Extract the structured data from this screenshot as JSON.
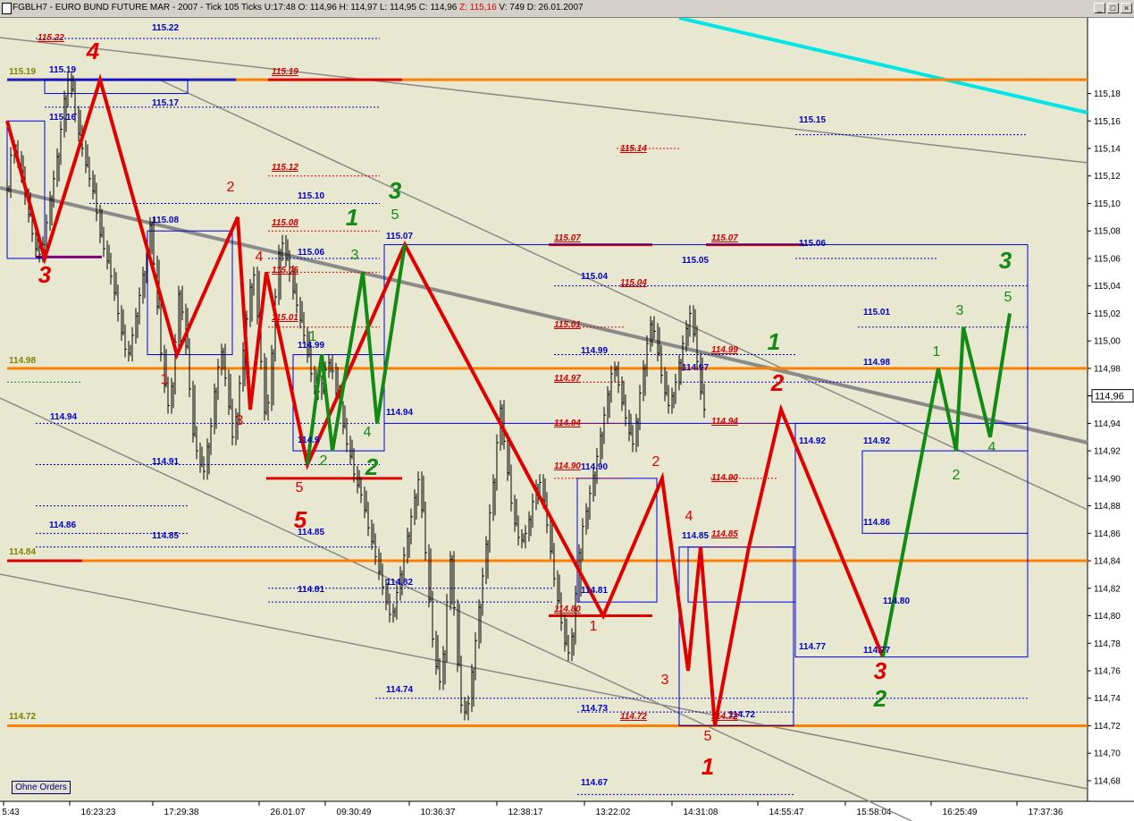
{
  "window": {
    "symbol": "FGBLH7",
    "instrument": "EURO BUND FUTURE",
    "contract": "MAR - 2007",
    "interval": "Tick 105 Ticks",
    "u_label": "U:",
    "u_value": "17:48",
    "o_label": "O:",
    "o_value": "114,96",
    "h_label": "H:",
    "h_value": "114,97",
    "l_label": "L:",
    "l_value": "114,95",
    "c_label": "C:",
    "c_value": "114,96",
    "z_label": "Z:",
    "z_value": "115,16",
    "v_label": "V:",
    "v_value": "749",
    "d_label": "D:",
    "d_value": "26.01.2007",
    "buttons": [
      "_",
      "□",
      "×"
    ]
  },
  "orders_button": "Ohne Orders",
  "chart_data": {
    "type": "line",
    "instrument": "EURO BUND FUTURE MAR - 2007",
    "colors": {
      "background": "#e8e8d0",
      "price_bars": "#000000",
      "red_wave": "#e00000",
      "green_wave": "#138a13",
      "level_orange": "#ff8000",
      "trend_gray": "#8a8a8a",
      "trend_cyan": "#00e5e5",
      "blue_box": "#0000e0",
      "axis_bg": "#ffffff"
    },
    "ylim": [
      114.665,
      115.235
    ],
    "x_ticks": [
      "5:43",
      "16:23:23",
      "17:29:38",
      "26.01.07",
      "09:30:49",
      "10:36:37",
      "12:38:17",
      "13:22:02",
      "14:31:08",
      "14:55:47",
      "15:58:04",
      "16:25:49",
      "17:37:36"
    ],
    "y_ticks": [
      "115,18",
      "115,16",
      "115,14",
      "115,12",
      "115,10",
      "115,08",
      "115,06",
      "115,04",
      "115,02",
      "115,00",
      "114,98",
      "114,96",
      "114,94",
      "114,92",
      "114,90",
      "114,88",
      "114,86",
      "114,84",
      "114,82",
      "114,80",
      "114,78",
      "114,76",
      "114,74",
      "114,72",
      "114,70",
      "114,68"
    ],
    "last_price": "114,96",
    "price_series": {
      "name": "FGBLH7",
      "x": [
        0,
        4,
        8,
        12,
        16,
        20,
        24,
        28,
        32,
        36,
        40,
        44,
        48,
        52,
        56,
        60,
        64,
        68,
        72,
        76,
        80,
        84,
        88,
        92,
        96,
        100,
        104,
        108,
        112,
        116,
        120,
        124,
        128,
        132,
        136,
        140,
        144,
        148,
        152,
        156,
        160,
        164,
        168,
        172,
        176,
        180,
        184,
        188,
        192,
        196,
        200,
        204,
        208,
        212,
        216,
        220,
        224,
        228,
        232,
        236,
        240,
        244,
        248,
        252,
        256,
        260,
        264,
        268,
        272,
        276,
        280,
        284,
        288,
        292,
        296,
        300,
        304,
        308,
        312,
        316,
        320,
        324,
        328,
        332,
        336,
        340,
        344,
        348,
        352,
        356,
        360,
        364,
        368,
        372,
        376,
        380,
        384,
        388,
        392,
        396,
        400,
        404,
        408,
        412,
        416,
        420,
        424,
        428,
        432,
        436,
        440,
        444,
        448,
        452,
        456,
        460,
        464,
        468,
        472,
        476,
        480,
        484,
        488,
        492,
        496,
        500,
        504,
        508,
        512,
        516,
        520,
        524,
        528,
        532,
        536,
        540,
        544,
        548,
        552,
        556,
        560,
        564,
        568,
        572,
        576,
        580,
        584,
        588,
        592,
        596,
        600,
        604,
        608,
        612,
        616,
        620,
        624,
        628,
        632,
        636,
        640,
        644,
        648,
        652,
        656,
        660,
        664,
        668,
        672,
        676,
        680,
        684,
        688,
        692,
        696,
        700,
        704,
        708,
        712,
        716,
        720,
        724,
        728,
        732,
        736,
        740,
        744,
        748,
        752,
        756,
        760,
        764,
        768,
        772,
        776,
        780,
        784,
        788,
        792,
        796,
        800,
        804,
        808,
        812,
        816,
        820,
        824,
        828,
        832,
        836,
        840,
        844,
        848,
        852,
        856,
        860,
        864,
        868,
        872,
        876,
        880,
        884,
        888,
        892,
        896,
        900,
        904,
        908,
        912,
        916,
        920,
        924,
        928,
        932,
        936,
        940,
        944,
        948,
        952,
        956,
        960,
        964,
        968,
        972,
        976,
        980,
        984,
        988,
        992,
        996,
        1000,
        1004,
        1008,
        1012,
        1016,
        1020,
        1024,
        1028,
        1032,
        1036,
        1040,
        1044,
        1048,
        1052,
        1056,
        1060,
        1064,
        1068,
        1072,
        1076,
        1080,
        1084,
        1088,
        1092,
        1096,
        1100,
        1104,
        1108,
        1112,
        1116,
        1120,
        1124,
        1128,
        1132,
        1136,
        1140,
        1144,
        1148,
        1152,
        1156
      ],
      "values": [
        115.11,
        115.135,
        115.14,
        115.132,
        115.121,
        115.105,
        115.092,
        115.078,
        115.067,
        115.063,
        115.07,
        115.086,
        115.103,
        115.118,
        115.134,
        115.154,
        115.176,
        115.19,
        115.183,
        115.165,
        115.151,
        115.14,
        115.128,
        115.118,
        115.109,
        115.093,
        115.077,
        115.067,
        115.058,
        115.047,
        115.035,
        115.02,
        115.006,
        114.994,
        114.991,
        115.004,
        115.018,
        115.033,
        115.048,
        115.065,
        115.084,
        115.056,
        115.025,
        114.991,
        114.968,
        114.953,
        114.967,
        114.999,
        115.034,
        115.021,
        114.996,
        114.965,
        114.932,
        114.92,
        114.91,
        114.905,
        114.923,
        114.938,
        114.963,
        114.981,
        114.992,
        114.973,
        114.952,
        114.93,
        114.945,
        114.969,
        114.993,
        115.016,
        115.039,
        115.048,
        115.018,
        114.985,
        114.948,
        114.955,
        114.991,
        115.032,
        115.064,
        115.071,
        115.06,
        115.049,
        115.036,
        115.026,
        115.015,
        115.004,
        114.99,
        114.976,
        114.967,
        114.963,
        114.969,
        114.979,
        114.984,
        114.978,
        114.962,
        114.95,
        114.938,
        114.925,
        114.916,
        114.903,
        114.895,
        114.888,
        114.877,
        114.864,
        114.854,
        114.843,
        114.832,
        114.821,
        114.81,
        114.801,
        114.803,
        114.817,
        114.83,
        114.844,
        114.858,
        114.872,
        114.886,
        114.899,
        114.877,
        114.846,
        114.812,
        114.783,
        114.763,
        114.752,
        114.772,
        114.81,
        114.841,
        114.806,
        114.765,
        114.735,
        114.73,
        114.736,
        114.759,
        114.782,
        114.806,
        114.829,
        114.852,
        114.875,
        114.897,
        114.926,
        114.951,
        114.927,
        114.904,
        114.882,
        114.867,
        114.857,
        114.855,
        114.86,
        114.87,
        114.883,
        114.893,
        114.897,
        114.884,
        114.866,
        114.847,
        114.827,
        114.811,
        114.795,
        114.78,
        114.773,
        114.785,
        114.816,
        114.846,
        114.865,
        114.876,
        114.889,
        114.902,
        114.916,
        114.931,
        114.946,
        114.961,
        114.976,
        114.979,
        114.968,
        114.955,
        114.944,
        114.933,
        114.925,
        114.941,
        114.962,
        114.98,
        114.998,
        115.012,
        115.007,
        114.991,
        114.975,
        114.962,
        114.953,
        114.96,
        114.97,
        114.984,
        114.998,
        115.009,
        115.02,
        115.005,
        114.985,
        114.963,
        114.95
      ]
    },
    "horizontal_levels": [
      {
        "value": 115.19,
        "label": "115.19"
      },
      {
        "value": 114.98,
        "label": "114.98"
      },
      {
        "value": 114.84,
        "label": "114.84"
      },
      {
        "value": 114.72,
        "label": "114.72"
      }
    ],
    "level_labels": {
      "blue": [
        {
          "label": "115.22",
          "value": 115.22
        },
        {
          "label": "115.19",
          "value": 115.19
        },
        {
          "label": "115.17",
          "value": 115.17
        },
        {
          "label": "115.16",
          "value": 115.16
        },
        {
          "label": "115.10",
          "value": 115.1
        },
        {
          "label": "115.08",
          "value": 115.08
        },
        {
          "label": "115.07",
          "value": 115.07
        },
        {
          "label": "115.06",
          "value": 115.06
        },
        {
          "label": "115.05",
          "value": 115.05
        },
        {
          "label": "115.04",
          "value": 115.04
        },
        {
          "label": "115.15",
          "value": 115.15
        },
        {
          "label": "115.06",
          "value": 115.06
        },
        {
          "label": "115.01",
          "value": 115.01
        },
        {
          "label": "114.99",
          "value": 114.99
        },
        {
          "label": "114.99",
          "value": 114.99
        },
        {
          "label": "114.98",
          "value": 114.98
        },
        {
          "label": "114.97",
          "value": 114.97
        },
        {
          "label": "114.94",
          "value": 114.94
        },
        {
          "label": "114.94",
          "value": 114.94
        },
        {
          "label": "114.92",
          "value": 114.92
        },
        {
          "label": "114.92",
          "value": 114.92
        },
        {
          "label": "114.91",
          "value": 114.91
        },
        {
          "label": "114.9",
          "value": 114.92
        },
        {
          "label": "114.90",
          "value": 114.9
        },
        {
          "label": "114.86",
          "value": 114.86
        },
        {
          "label": "114.86",
          "value": 114.86
        },
        {
          "label": "114.85",
          "value": 114.85
        },
        {
          "label": "114.85",
          "value": 114.85
        },
        {
          "label": "114.85",
          "value": 114.85
        },
        {
          "label": "114.82",
          "value": 114.82
        },
        {
          "label": "114.81",
          "value": 114.81
        },
        {
          "label": "114.81",
          "value": 114.81
        },
        {
          "label": "114.80",
          "value": 114.8
        },
        {
          "label": "114.77",
          "value": 114.77
        },
        {
          "label": "114.77",
          "value": 114.77
        },
        {
          "label": "114.74",
          "value": 114.74
        },
        {
          "label": "114.73",
          "value": 114.73
        },
        {
          "label": "114.72",
          "value": 114.72
        },
        {
          "label": "114.67",
          "value": 114.67
        }
      ],
      "red": [
        {
          "label": "115.22",
          "value": 115.22
        },
        {
          "label": "115.19",
          "value": 115.19
        },
        {
          "label": "115.12",
          "value": 115.12
        },
        {
          "label": "115.08",
          "value": 115.08
        },
        {
          "label": "115.05",
          "value": 115.05
        },
        {
          "label": "115.01",
          "value": 115.01
        },
        {
          "label": "115.14",
          "value": 115.14
        },
        {
          "label": "115.07",
          "value": 115.07
        },
        {
          "label": "115.07",
          "value": 115.07
        },
        {
          "label": "115.04",
          "value": 115.04
        },
        {
          "label": "115.01",
          "value": 115.01
        },
        {
          "label": "114.99",
          "value": 114.99
        },
        {
          "label": "114.97",
          "value": 114.97
        },
        {
          "label": "114.94",
          "value": 114.94
        },
        {
          "label": "114.94",
          "value": 114.94
        },
        {
          "label": "114.90",
          "value": 114.9
        },
        {
          "label": "114.90",
          "value": 114.9
        },
        {
          "label": "114.85",
          "value": 114.85
        },
        {
          "label": "114.80",
          "value": 114.8
        },
        {
          "label": "114.72",
          "value": 114.72
        },
        {
          "label": "114.72",
          "value": 114.72
        }
      ],
      "olive": [
        {
          "label": "115.19",
          "value": 115.19
        },
        {
          "label": "114.98",
          "value": 114.98
        },
        {
          "label": "114.84",
          "value": 114.84
        },
        {
          "label": "114.72",
          "value": 114.72
        }
      ]
    },
    "wave_labels": {
      "red_large": [
        "4",
        "3",
        "5",
        "1",
        "3",
        "1",
        "2"
      ],
      "red_small": [
        "2",
        "1",
        "4",
        "3",
        "5",
        "2",
        "4",
        "1",
        "3",
        "5"
      ],
      "green_large": [
        "3",
        "1",
        "2",
        "1",
        "3",
        "2"
      ],
      "green_small": [
        "5",
        "3",
        "1",
        "2",
        "4",
        "3",
        "5",
        "1",
        "2",
        "4"
      ]
    }
  }
}
